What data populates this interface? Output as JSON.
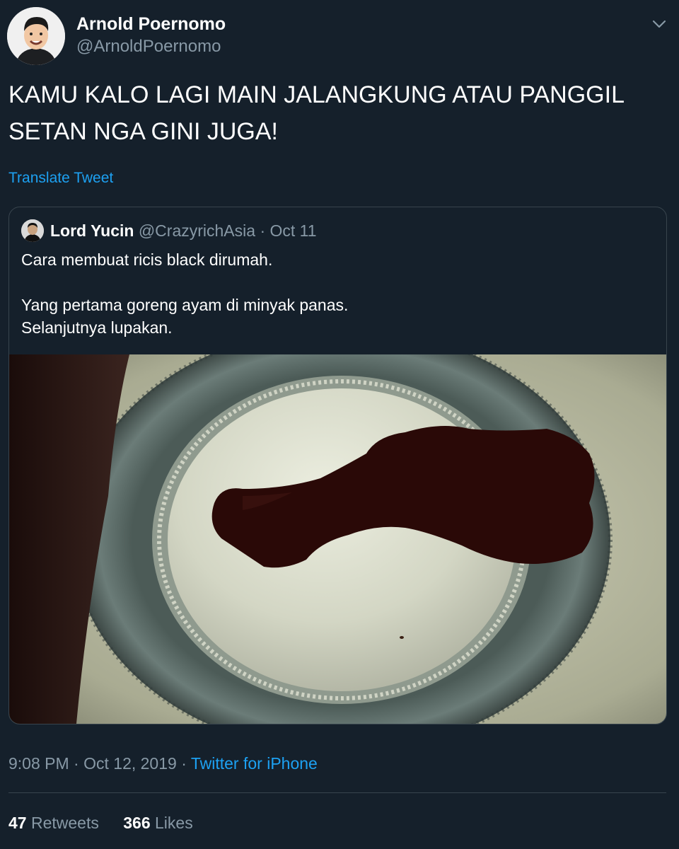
{
  "author": {
    "name": "Arnold Poernomo",
    "handle": "@ArnoldPoernomo"
  },
  "tweet": {
    "text": "KAMU KALO LAGI MAIN JALANGKUNG ATAU PANGGIL SETAN NGA GINI JUGA!",
    "translate_label": "Translate Tweet"
  },
  "quoted": {
    "name": "Lord Yucin",
    "handle": "@CrazyrichAsia",
    "separator": "·",
    "date": "Oct 11",
    "text_lines": [
      "Cara membuat ricis black dirumah.",
      "Yang pertama goreng ayam di minyak panas.",
      "Selanjutnya lupakan."
    ]
  },
  "meta": {
    "time": "9:08 PM",
    "separator": "·",
    "date": "Oct 12, 2019",
    "source": "Twitter for iPhone"
  },
  "stats": {
    "retweets_count": "47",
    "retweets_label": "Retweets",
    "likes_count": "366",
    "likes_label": "Likes"
  },
  "colors": {
    "background": "#15202b",
    "accent": "#1da1f2",
    "secondary_text": "#8899a6",
    "border": "#38444d"
  }
}
